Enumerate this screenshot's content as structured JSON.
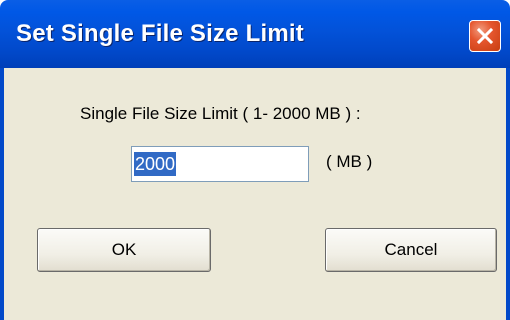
{
  "dialog": {
    "title": "Set Single File Size Limit",
    "close_icon": "close-x-icon",
    "prompt": "Single File Size Limit ( 1- 2000 MB ) :",
    "input_value": "2000",
    "unit": "( MB )",
    "ok_label": "OK",
    "cancel_label": "Cancel"
  },
  "colors": {
    "titlebar": "#0352d9",
    "close_button": "#e5562e",
    "client_background": "#ece9d8",
    "selection": "#316ac5"
  }
}
